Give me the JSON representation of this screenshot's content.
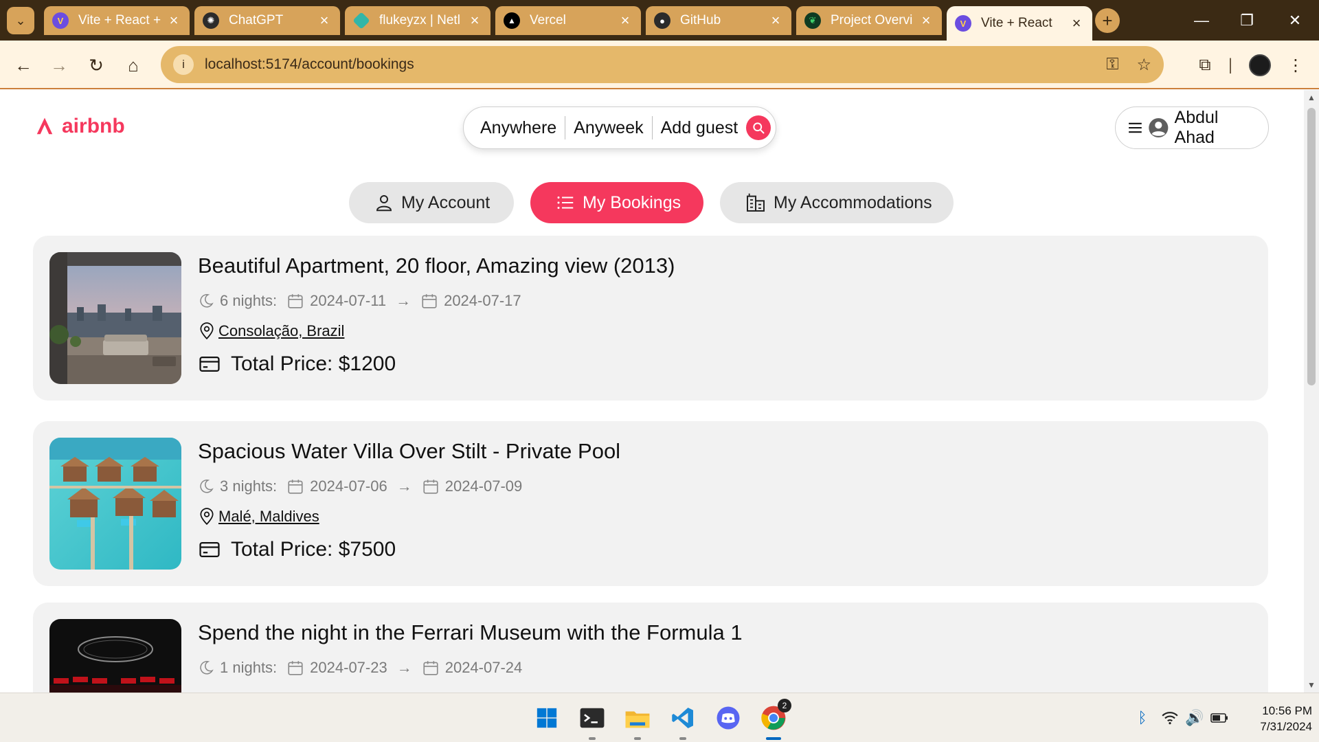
{
  "browser": {
    "tabs": [
      {
        "title": "Vite + React +",
        "favicon": "vite-icon",
        "color": "#b26bff"
      },
      {
        "title": "ChatGPT",
        "favicon": "openai-icon",
        "color": "#ffffff"
      },
      {
        "title": "flukeyzx | Netl",
        "favicon": "netlify-icon",
        "color": "#32b6a8"
      },
      {
        "title": "Vercel",
        "favicon": "vercel-icon",
        "color": "#000000"
      },
      {
        "title": "GitHub",
        "favicon": "github-icon",
        "color": "#2b2b2b"
      },
      {
        "title": "Project Overvi",
        "favicon": "mongodb-icon",
        "color": "#0f3b22"
      },
      {
        "title": "Vite + React",
        "favicon": "vite-icon",
        "color": "#b26bff"
      }
    ],
    "url": "localhost:5174/account/bookings"
  },
  "header": {
    "logo_text": "airbnb",
    "search": {
      "where": "Anywhere",
      "when": "Anyweek",
      "guests": "Add guest"
    },
    "user_name": "Abdul Ahad"
  },
  "account_nav": {
    "account": "My Account",
    "bookings": "My Bookings",
    "accommodations": "My Accommodations"
  },
  "bookings": [
    {
      "title": "Beautiful Apartment, 20 floor, Amazing view (2013)",
      "nights": "6 nights:",
      "check_in": "2024-07-11",
      "arrow": "→",
      "check_out": "2024-07-17",
      "location": "Consolação, Brazil",
      "price": "Total Price: $1200"
    },
    {
      "title": "Spacious Water Villa Over Stilt - Private Pool",
      "nights": "3 nights:",
      "check_in": "2024-07-06",
      "arrow": "→",
      "check_out": "2024-07-09",
      "location": "Malé, Maldives",
      "price": "Total Price: $7500"
    },
    {
      "title": "Spend the night in the Ferrari Museum with the Formula 1",
      "nights": "1 nights:",
      "check_in": "2024-07-23",
      "arrow": "→",
      "check_out": "2024-07-24",
      "location": "",
      "price": ""
    }
  ],
  "taskbar": {
    "time": "10:56 PM",
    "date": "7/31/2024",
    "chrome_badge": "2"
  },
  "colors": {
    "brand": "#f5385d",
    "card_bg": "#f2f2f2",
    "tab_bar": "#3b2a14",
    "toolbar": "#fff4e2",
    "omnibox": "#e5b86a"
  }
}
